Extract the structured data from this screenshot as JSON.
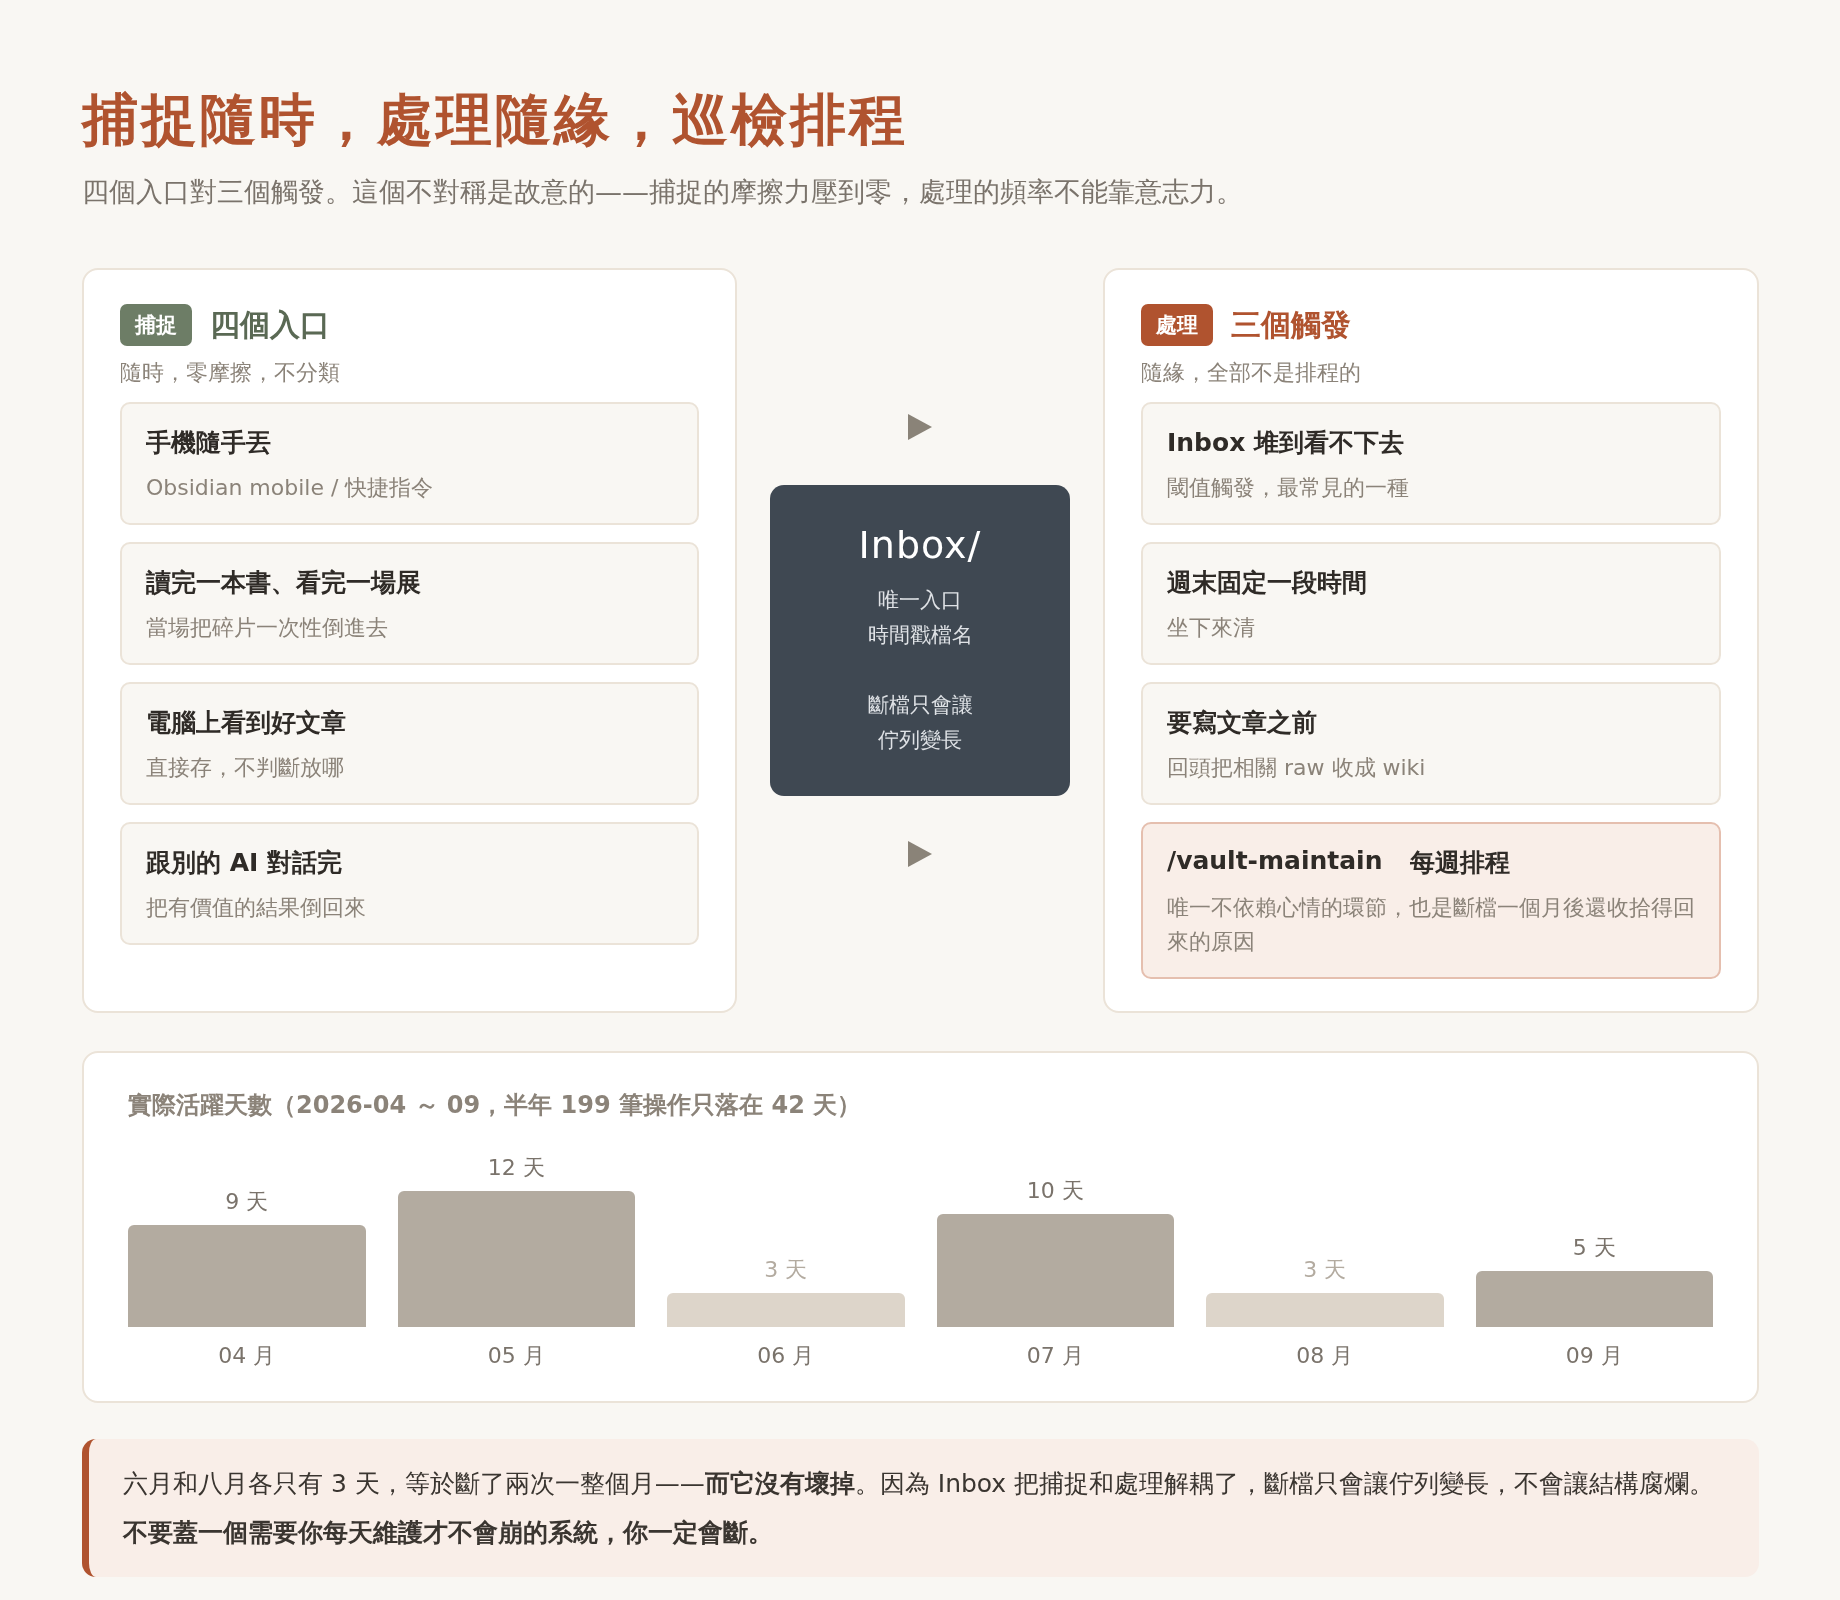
{
  "title": "捕捉隨時，處理隨緣，巡檢排程",
  "subtitle": "四個入口對三個觸發。這個不對稱是故意的——捕捉的摩擦力壓到零，處理的頻率不能靠意志力。",
  "panels": [
    {
      "kind": "capture",
      "badge": "捕捉",
      "heading": "四個入口",
      "caption": "隨時，零摩擦，不分類",
      "items": [
        {
          "title": "手機隨手丟",
          "detail": "Obsidian mobile / 快捷指令",
          "highlighted": false
        },
        {
          "title": "讀完一本書、看完一場展",
          "detail": "當場把碎片一次性倒進去",
          "highlighted": false
        },
        {
          "title": "電腦上看到好文章",
          "detail": "直接存，不判斷放哪",
          "highlighted": false
        },
        {
          "title": "跟別的 AI 對話完",
          "detail": "把有價值的結果倒回來",
          "highlighted": false
        }
      ]
    },
    {
      "kind": "process",
      "badge": "處理",
      "heading": "三個觸發",
      "caption": "隨緣，全部不是排程的",
      "items": [
        {
          "title": "Inbox 堆到看不下去",
          "detail": "閾值觸發，最常見的一種",
          "highlighted": false
        },
        {
          "title": "週末固定一段時間",
          "detail": "坐下來清",
          "highlighted": false
        },
        {
          "title": "要寫文章之前",
          "detail": "回頭把相關 raw 收成 wiki",
          "highlighted": false
        },
        {
          "title": "/vault-maintain",
          "tag": "每週排程",
          "detail": "唯一不依賴心情的環節，也是斷檔一個月後還收拾得回來的原因",
          "highlighted": true
        }
      ]
    }
  ],
  "hub": {
    "title": "Inbox/",
    "groups": [
      [
        "唯一入口",
        "時間戳檔名"
      ],
      [
        "斷檔只會讓",
        "佇列變長"
      ]
    ]
  },
  "activity": {
    "title": "實際活躍天數（2026-04 ～ 09，半年 199 筆操作只落在 42 天）",
    "chart_data": {
      "type": "bar",
      "categories": [
        "04 月",
        "05 月",
        "06 月",
        "07 月",
        "08 月",
        "09 月"
      ],
      "series": [
        {
          "color": "#b3aba0",
          "values": [
            9,
            12,
            null,
            10,
            null,
            5
          ]
        },
        {
          "color": "#ddd5ca",
          "values": [
            null,
            null,
            3,
            null,
            3,
            null
          ]
        }
      ],
      "ylabel": "天",
      "data_labels": true
    }
  },
  "note": "六月和八月各只有 3 天，等於斷了兩次一整個月——**而它沒有壞掉**。因為 Inbox 把捕捉和處理解耦了，斷檔只會讓佇列變長，不會讓結構腐爛。**不要蓋一個需要你每天維護才不會崩的系統，你一定會斷。**"
}
